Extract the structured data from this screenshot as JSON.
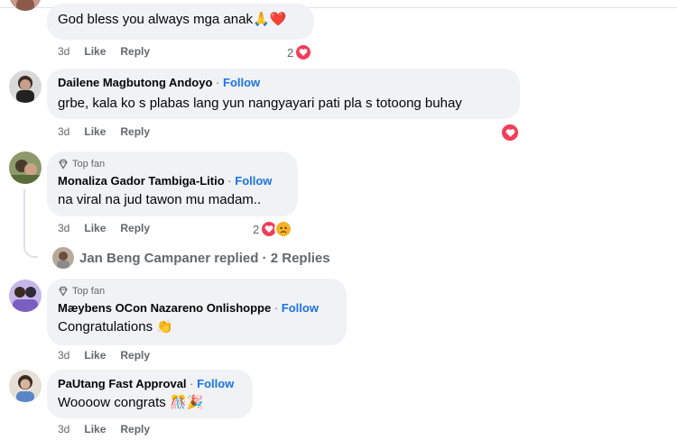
{
  "comments": [
    {
      "text": "God bless you always mga anak🙏❤️",
      "time": "3d",
      "like": "Like",
      "reply": "Reply",
      "reaction_count": "2",
      "reaction_icons": [
        "heart-icon"
      ]
    },
    {
      "name": "Dailene Magbutong Andoyo",
      "separator": "·",
      "follow": "Follow",
      "text": "grbe, kala ko s plabas lang yun nangyayari pati pla s totoong buhay",
      "time": "3d",
      "like": "Like",
      "reply": "Reply",
      "reaction_icons": [
        "heart-icon"
      ]
    },
    {
      "badge": "Top fan",
      "name": "Monaliza Gador Tambiga-Litio",
      "separator": "·",
      "follow": "Follow",
      "text": "na viral na jud tawon mu madam..",
      "time": "3d",
      "like": "Like",
      "reply": "Reply",
      "reaction_count": "2",
      "reaction_icons": [
        "heart-icon",
        "sad-face-icon"
      ],
      "replies_summary": "Jan Beng Campaner replied · 2 Replies"
    },
    {
      "badge": "Top fan",
      "name": "Mæybens OCon Nazareno Onlishoppe",
      "separator": "·",
      "follow": "Follow",
      "text": "Congratulations 👏",
      "time": "3d",
      "like": "Like",
      "reply": "Reply"
    },
    {
      "name": "PaUtang Fast Approval",
      "separator": "·",
      "follow": "Follow",
      "text": "Woooow congrats 🎊🎉",
      "time": "3d",
      "like": "Like",
      "reply": "Reply"
    }
  ],
  "colors": {
    "follow": "#1b74e4",
    "bubble": "#f0f2f5",
    "meta": "#65676b",
    "love": "#f33e58"
  }
}
